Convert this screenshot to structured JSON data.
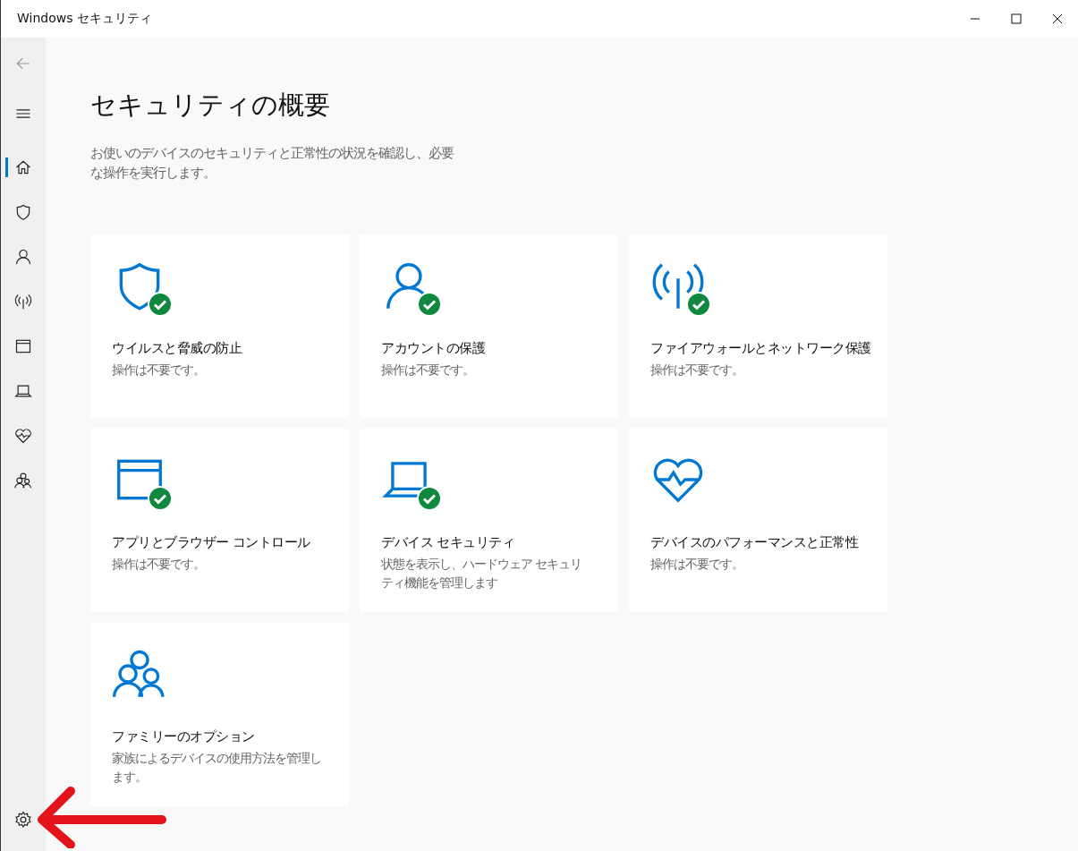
{
  "window": {
    "title": "Windows セキュリティ"
  },
  "sidebar": {
    "items": [
      {
        "kind": "back",
        "selected": false
      },
      {
        "kind": "menu",
        "selected": false
      },
      {
        "kind": "home",
        "selected": true
      },
      {
        "kind": "shield",
        "selected": false
      },
      {
        "kind": "person",
        "selected": false
      },
      {
        "kind": "antenna",
        "selected": false
      },
      {
        "kind": "window",
        "selected": false
      },
      {
        "kind": "laptop",
        "selected": false
      },
      {
        "kind": "heart",
        "selected": false
      },
      {
        "kind": "family",
        "selected": false
      }
    ],
    "footer_items": [
      {
        "kind": "settings",
        "selected": false
      }
    ]
  },
  "page": {
    "heading": "セキュリティの概要",
    "description": "お使いのデバイスのセキュリティと正常性の状況を確認し、必要な操作を実行します。"
  },
  "cards": [
    {
      "kind": "shield",
      "title": "ウイルスと脅威の防止",
      "status": "操作は不要です。",
      "ok": true
    },
    {
      "kind": "person",
      "title": "アカウントの保護",
      "status": "操作は不要です。",
      "ok": true
    },
    {
      "kind": "antenna",
      "title": "ファイアウォールとネットワーク保護",
      "status": "操作は不要です。",
      "ok": true
    },
    {
      "kind": "window",
      "title": "アプリとブラウザー コントロール",
      "status": "操作は不要です。",
      "ok": true
    },
    {
      "kind": "laptop",
      "title": "デバイス セキュリティ",
      "status": "状態を表示し、ハードウェア セキュリティ機能を管理します",
      "ok": true
    },
    {
      "kind": "heart",
      "title": "デバイスのパフォーマンスと正常性",
      "status": "操作は不要です。",
      "ok": false
    },
    {
      "kind": "family",
      "title": "ファミリーのオプション",
      "status": "家族によるデバイスの使用方法を管理します。",
      "ok": false
    }
  ]
}
